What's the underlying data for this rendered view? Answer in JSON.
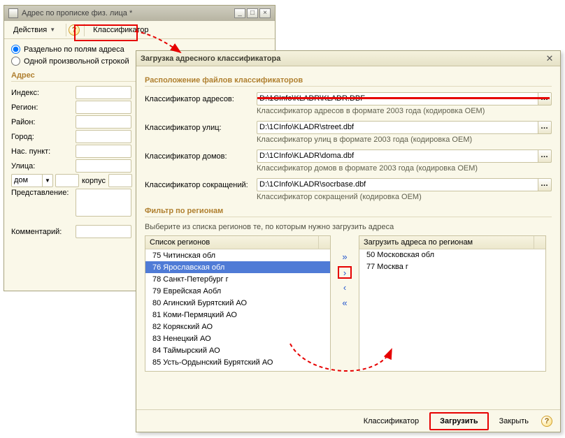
{
  "parent": {
    "title": "Адрес по прописке физ. лица *",
    "actions_label": "Действия",
    "classifier_label": "Классификатор",
    "radio_fields": "Раздельно по полям адреса",
    "radio_free": "Одной произвольной строкой",
    "section_address": "Адрес",
    "labels": {
      "index": "Индекс:",
      "region": "Регион:",
      "district": "Район:",
      "city": "Город:",
      "settlement": "Нас. пункт:",
      "street": "Улица:",
      "house_type": "дом",
      "korpus": "корпус",
      "representation": "Представление:",
      "comment": "Комментарий:"
    }
  },
  "dialog": {
    "title": "Загрузка адресного классификатора",
    "section_location": "Расположение файлов классификаторов",
    "rows": {
      "addresses": {
        "label": "Классификатор адресов:",
        "value": "D:\\1CInfo\\KLADR\\KLADR.DBF",
        "hint": "Классификатор адресов в формате  2003 года  (кодировка OEM)"
      },
      "streets": {
        "label": "Классификатор улиц:",
        "value": "D:\\1CInfo\\KLADR\\street.dbf",
        "hint": "Классификатор улиц в формате  2003 года  (кодировка OEM)"
      },
      "houses": {
        "label": "Классификатор домов:",
        "value": "D:\\1CInfo\\KLADR\\doma.dbf",
        "hint": "Классификатор домов в формате  2003 года  (кодировка OEM)"
      },
      "abbr": {
        "label": "Классификатор сокращений:",
        "value": "D:\\1CInfo\\KLADR\\socrbase.dbf",
        "hint": "Классификатор сокращений (кодировка OEM)"
      }
    },
    "section_filter": "Фильтр по регионам",
    "filter_help": "Выберите из списка регионов те, по которым нужно загрузить адреса",
    "source_header": "Список регионов",
    "target_header": "Загрузить адреса по регионам",
    "source_items": [
      "75 Читинская обл",
      "76 Ярославская обл",
      "78 Санкт-Петербург г",
      "79 Еврейская Аобл",
      "80 Агинский Бурятский АО",
      "81 Коми-Пермяцкий АО",
      "82 Корякский АО",
      "83 Ненецкий АО",
      "84 Таймырский АО",
      "85 Усть-Ордынский Бурятский АО"
    ],
    "selected_source_index": 1,
    "target_items": [
      "50 Московская обл",
      "77 Москва г"
    ],
    "footer": {
      "classifier": "Классификатор",
      "load": "Загрузить",
      "close": "Закрыть"
    }
  }
}
